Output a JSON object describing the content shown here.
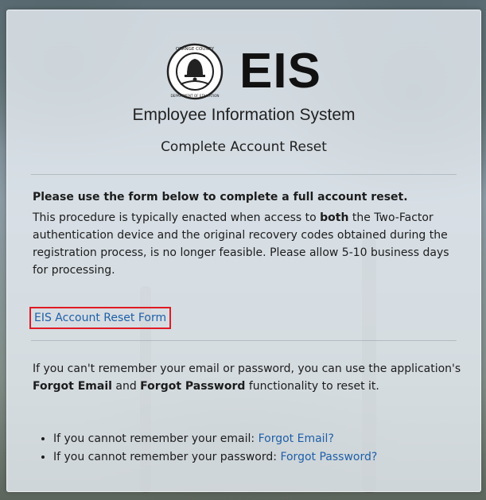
{
  "brand": {
    "logo_text": "EIS",
    "seal_top_text": "ORANGE COUNTY",
    "seal_bottom_text": "DEPARTMENT OF EDUCATION",
    "subtitle": "Employee Information System"
  },
  "page": {
    "title": "Complete Account Reset"
  },
  "reset_section": {
    "lead": "Please use the form below to complete a full account reset.",
    "para_part1": "This procedure is typically enacted when access to ",
    "para_bold": "both",
    "para_part2": " the Two-Factor authentication device and the original recovery codes obtained during the registration process, is no longer feasible. Please allow 5-10 business days for processing.",
    "form_link": "EIS Account Reset Form"
  },
  "forgot_section": {
    "para_part1": "If you can't remember your email or password, you can use the application's ",
    "bold_email": "Forgot Email",
    "para_and": " and ",
    "bold_password": "Forgot Password",
    "para_part2": " functionality to reset it.",
    "items": [
      {
        "text": "If you cannot remember your email: ",
        "link": "Forgot Email?"
      },
      {
        "text": "If you cannot remember your password: ",
        "link": "Forgot Password?"
      }
    ]
  },
  "colors": {
    "link": "#1f5fa8",
    "highlight_box": "#e01b24"
  }
}
